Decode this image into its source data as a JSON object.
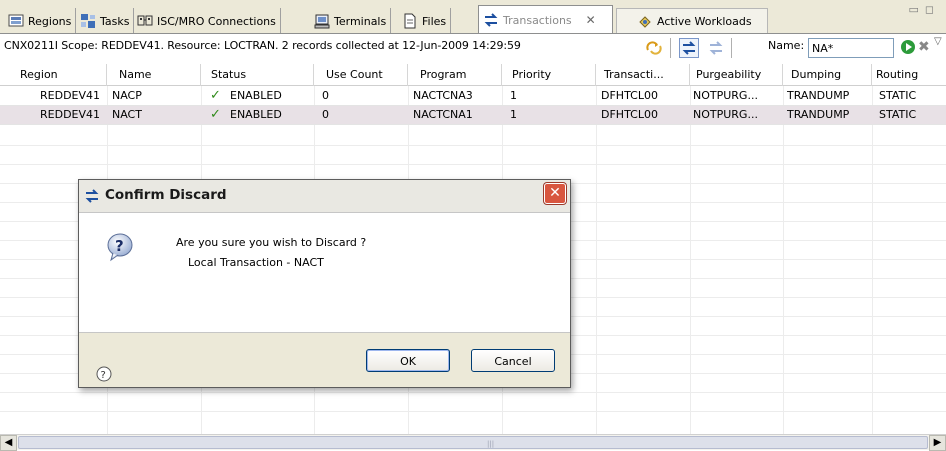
{
  "tabs": [
    {
      "label": "Regions",
      "icon": "regions-icon"
    },
    {
      "label": "Tasks",
      "icon": "tasks-icon"
    },
    {
      "label": "ISC/MRO Connections",
      "icon": "connections-icon"
    },
    {
      "label": "Terminals",
      "icon": "terminals-icon"
    },
    {
      "label": "Files",
      "icon": "files-icon"
    },
    {
      "label": "Transactions",
      "icon": "transactions-icon",
      "active": true
    },
    {
      "label": "Active Workloads",
      "icon": "workloads-icon"
    }
  ],
  "status_message": "CNX0211I Scope: REDDEV41. Resource: LOCTRAN. 2 records collected at 12-Jun-2009 14:29:59",
  "filter": {
    "name_label": "Name:",
    "name_value": "NA*"
  },
  "table": {
    "columns": [
      "Region",
      "Name",
      "Status",
      "Use Count",
      "Program",
      "Priority",
      "Transacti...",
      "Purgeability",
      "Dumping",
      "Routing"
    ],
    "rows": [
      {
        "region": "REDDEV41",
        "name": "NACP",
        "status": "ENABLED",
        "use_count": "0",
        "program": "NACTCNA3",
        "priority": "1",
        "transaction_class": "DFHTCL00",
        "purgeability": "NOTPURG...",
        "dumping": "TRANDUMP",
        "routing": "STATIC"
      },
      {
        "region": "REDDEV41",
        "name": "NACT",
        "status": "ENABLED",
        "use_count": "0",
        "program": "NACTCNA1",
        "priority": "1",
        "transaction_class": "DFHTCL00",
        "purgeability": "NOTPURG...",
        "dumping": "TRANDUMP",
        "routing": "STATIC"
      }
    ]
  },
  "dialog": {
    "title": "Confirm Discard",
    "message": "Are you sure you wish to Discard ?",
    "detail": "Local Transaction - NACT",
    "ok_label": "OK",
    "cancel_label": "Cancel"
  },
  "colors": {
    "selected_row": "#e8e1e6",
    "check": "#2f8a1a",
    "close_button": "#d8563f",
    "accent_blue": "#1c4fa0"
  }
}
